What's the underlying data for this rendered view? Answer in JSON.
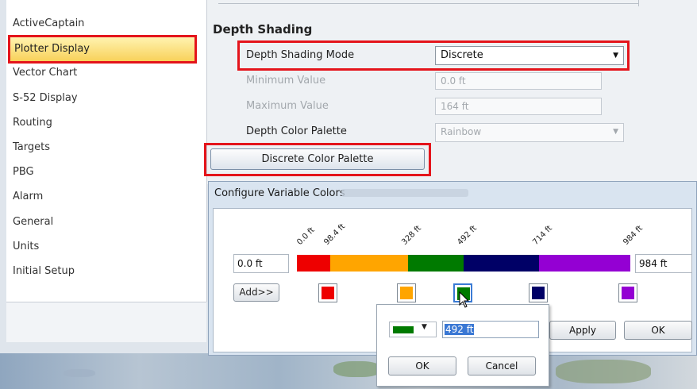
{
  "sidebar": {
    "items": [
      {
        "label": "ActiveCaptain"
      },
      {
        "label": "Plotter Display"
      },
      {
        "label": "Vector Chart"
      },
      {
        "label": "S-52 Display"
      },
      {
        "label": "Routing"
      },
      {
        "label": "Targets"
      },
      {
        "label": "PBG"
      },
      {
        "label": "Alarm"
      },
      {
        "label": "General"
      },
      {
        "label": "Units"
      },
      {
        "label": "Initial Setup"
      }
    ]
  },
  "settings": {
    "section_title": "Depth Shading",
    "mode_label": "Depth Shading Mode",
    "mode_value": "Discrete",
    "min_label": "Minimum Value",
    "min_value": "0.0 ft",
    "max_label": "Maximum Value",
    "max_value": "164 ft",
    "palette_label": "Depth Color Palette",
    "palette_value": "Rainbow",
    "discrete_button": "Discrete Color Palette"
  },
  "dialog": {
    "title": "Configure Variable Colors",
    "start_value": "0.0 ft",
    "end_value": "984 ft",
    "ticks": [
      "0.0 ft",
      "98.4 ft",
      "328 ft",
      "492 ft",
      "714 ft",
      "984 ft"
    ],
    "segments": [
      {
        "color": "#ee0000",
        "fraction": 0.1
      },
      {
        "color": "#ffa500",
        "fraction": 0.233
      },
      {
        "color": "#007a00",
        "fraction": 0.167
      },
      {
        "color": "#000066",
        "fraction": 0.226
      },
      {
        "color": "#9400d3",
        "fraction": 0.274
      }
    ],
    "swatches": [
      {
        "color": "#ee0000",
        "icon": "red-swatch"
      },
      {
        "color": "#ffa500",
        "icon": "orange-swatch"
      },
      {
        "color": "#007a00",
        "icon": "green-swatch"
      },
      {
        "color": "#000066",
        "icon": "navy-swatch"
      },
      {
        "color": "#9400d3",
        "icon": "purple-swatch"
      }
    ],
    "add_button": "Add>>",
    "apply_button": "Apply",
    "ok_button": "OK"
  },
  "popup": {
    "selected_color": "#007a00",
    "value": "492 ft",
    "ok_button": "OK",
    "cancel_button": "Cancel"
  }
}
